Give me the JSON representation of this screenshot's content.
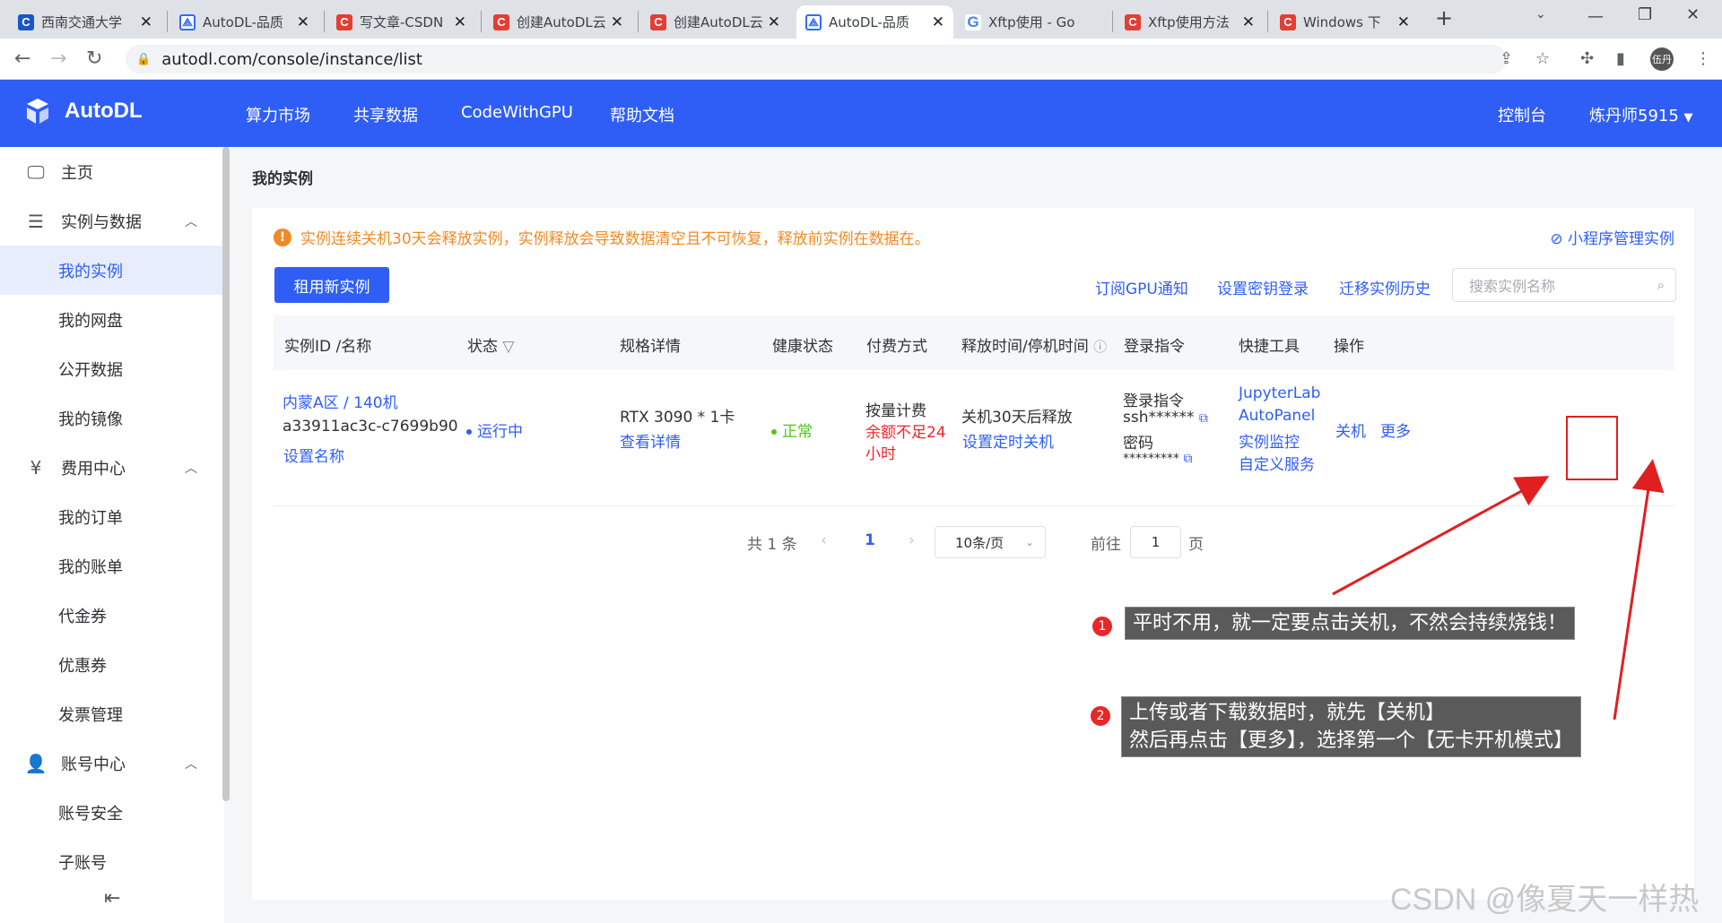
{
  "browser": {
    "tabs": [
      {
        "title": "西南交通大学",
        "icon": "csdn-c-blue"
      },
      {
        "title": "AutoDL-品质",
        "icon": "autodl"
      },
      {
        "title": "写文章-CSDN",
        "icon": "csdn-c"
      },
      {
        "title": "创建AutoDL云",
        "icon": "csdn-c"
      },
      {
        "title": "创建AutoDL云",
        "icon": "csdn-c"
      },
      {
        "title": "AutoDL-品质",
        "icon": "autodl",
        "active": true
      },
      {
        "title": "Xftp使用 - Go",
        "icon": "google"
      },
      {
        "title": "Xftp使用方法",
        "icon": "csdn-c"
      },
      {
        "title": "Windows 下",
        "icon": "csdn-c"
      }
    ],
    "new_tab": "+",
    "url": "autodl.com/console/instance/list",
    "profile": "伍丹"
  },
  "header": {
    "logo": "AutoDL",
    "nav": [
      "算力市场",
      "共享数据",
      "CodeWithGPU",
      "帮助文档"
    ],
    "console": "控制台",
    "user": "炼丹师5915"
  },
  "sidebar": {
    "items": [
      {
        "label": "主页",
        "type": "top",
        "icon": "monitor-icon"
      },
      {
        "label": "实例与数据",
        "type": "top",
        "icon": "layers-icon",
        "expanded": true
      },
      {
        "label": "我的实例",
        "type": "sub",
        "active": true
      },
      {
        "label": "我的网盘",
        "type": "sub"
      },
      {
        "label": "公开数据",
        "type": "sub"
      },
      {
        "label": "我的镜像",
        "type": "sub"
      },
      {
        "label": "费用中心",
        "type": "top",
        "icon": "yen-icon",
        "expanded": true
      },
      {
        "label": "我的订单",
        "type": "sub"
      },
      {
        "label": "我的账单",
        "type": "sub"
      },
      {
        "label": "代金券",
        "type": "sub"
      },
      {
        "label": "优惠券",
        "type": "sub"
      },
      {
        "label": "发票管理",
        "type": "sub"
      },
      {
        "label": "账号中心",
        "type": "top",
        "icon": "user-icon",
        "expanded": true
      },
      {
        "label": "账号安全",
        "type": "sub"
      },
      {
        "label": "子账号",
        "type": "sub"
      }
    ]
  },
  "main": {
    "title": "我的实例",
    "warning": "实例连续关机30天会释放实例，实例释放会导致数据清空且不可恢复，释放前实例在数据在。",
    "mini_program": "小程序管理实例",
    "rent_button": "租用新实例",
    "toolbar_links": [
      "订阅GPU通知",
      "设置密钥登录",
      "迁移实例历史"
    ],
    "search_placeholder": "搜索实例名称",
    "columns": [
      "实例ID /名称",
      "状态",
      "规格详情",
      "健康状态",
      "付费方式",
      "释放时间/停机时间",
      "登录指令",
      "快捷工具",
      "操作"
    ],
    "row": {
      "region": "内蒙A区 / 140机",
      "id": "a33911ac3c-c7699b90",
      "set_name": "设置名称",
      "status": "运行中",
      "spec": "RTX 3090 * 1卡",
      "spec_detail": "查看详情",
      "health": "正常",
      "billing": "按量计费",
      "balance_warning_1": "余额不足24",
      "balance_warning_2": "小时",
      "release": "关机30天后释放",
      "set_shutdown": "设置定时关机",
      "login_label": "登录指令",
      "ssh": "ssh******",
      "pwd_label": "密码",
      "pwd": "*********",
      "tools": [
        "JupyterLab",
        "AutoPanel",
        "实例监控",
        "自定义服务"
      ],
      "action_shutdown": "关机",
      "action_more": "更多"
    },
    "pagination": {
      "total": "共 1 条",
      "current": "1",
      "page_size": "10条/页",
      "goto_label": "前往",
      "goto_value": "1",
      "page_unit": "页"
    }
  },
  "annotations": [
    {
      "num": "1",
      "text": "平时不用，就一定要点击关机，不然会持续烧钱！"
    },
    {
      "num": "2",
      "line1": "上传或者下载数据时，就先【关机】",
      "line2": "然后再点击【更多】，选择第一个【无卡开机模式】"
    }
  ],
  "watermark": "CSDN @像夏天一样热",
  "colors": {
    "brand": "#2f5ef7",
    "warning": "#f08a24",
    "danger": "#f5222d",
    "success": "#52c41a",
    "annotation_red": "#e02020"
  }
}
